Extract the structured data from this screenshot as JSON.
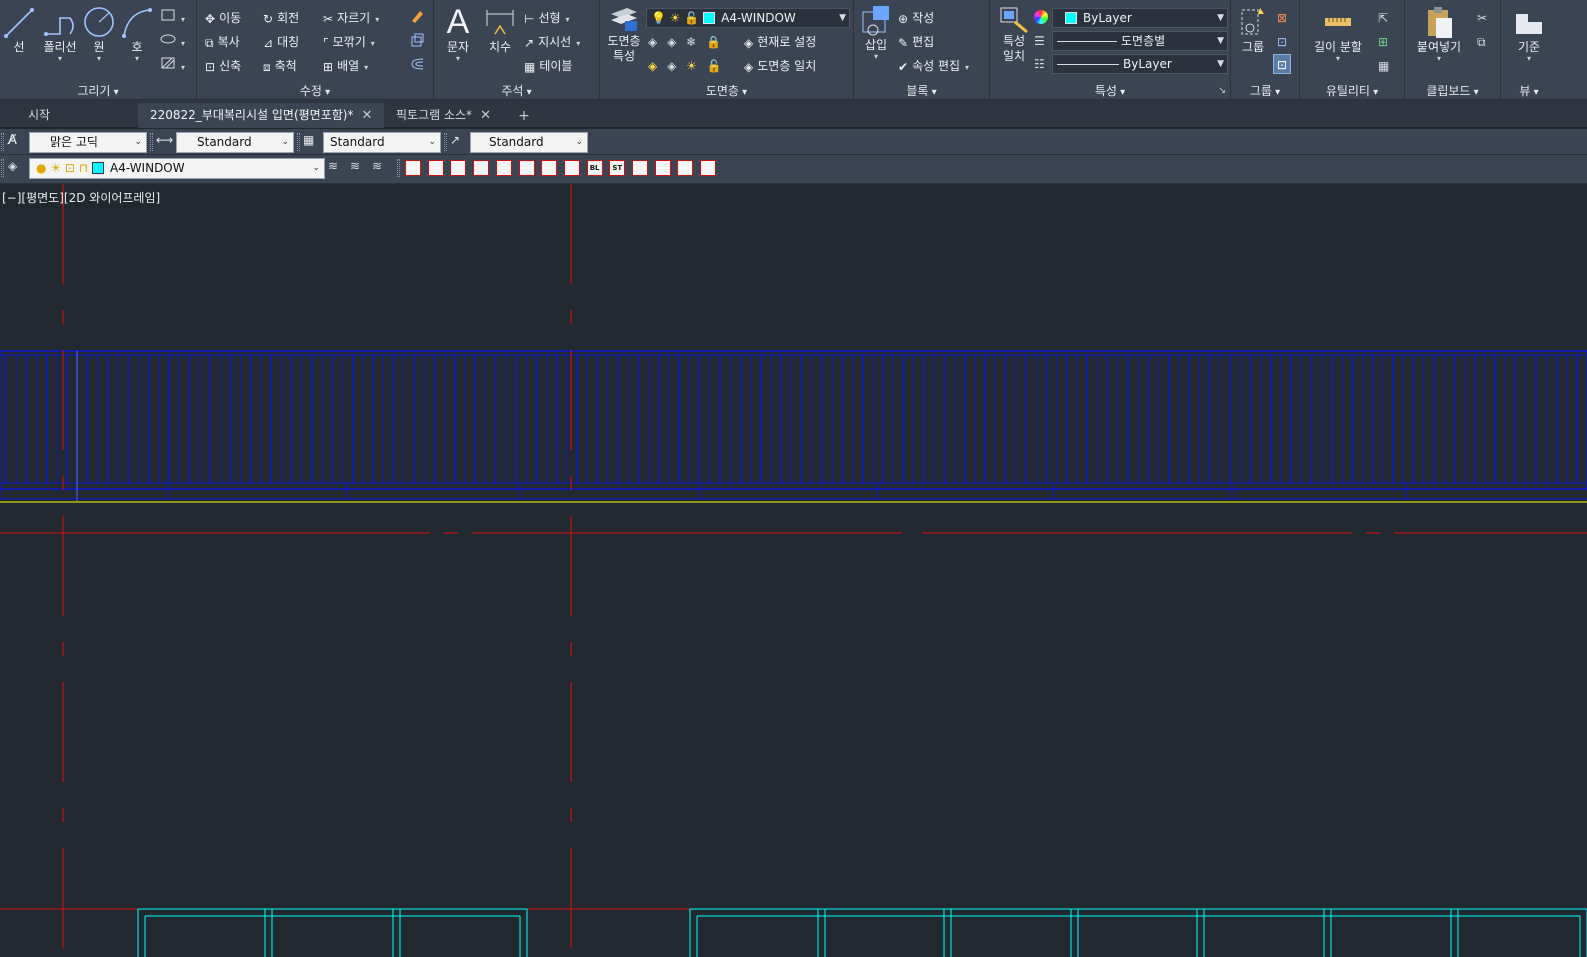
{
  "ribbon": {
    "draw": {
      "title": "그리기",
      "line": "선",
      "polyline": "폴리선",
      "circle": "원",
      "arc": "호"
    },
    "modify": {
      "title": "수정",
      "move": "이동",
      "rotate": "회전",
      "trim": "자르기",
      "copy": "복사",
      "mirror": "대칭",
      "fillet": "모깎기",
      "stretch": "신축",
      "scale": "축척",
      "array": "배열"
    },
    "annotation": {
      "title": "주석",
      "text": "문자",
      "dimension": "치수",
      "linear": "선형",
      "leader": "지시선",
      "table": "테이블"
    },
    "layers": {
      "title": "도면층",
      "properties_line1": "도면층",
      "properties_line2": "특성",
      "current_layer": "A4-WINDOW",
      "set_current": "현재로 설정",
      "match_layer": "도면층 일치"
    },
    "block": {
      "title": "블록",
      "insert": "삽입",
      "create": "작성",
      "edit": "편집",
      "edit_attributes": "속성 편집"
    },
    "properties": {
      "title": "특성",
      "match_line1": "특성",
      "match_line2": "일치",
      "color": "ByLayer",
      "lineweight": "도면층별",
      "linetype": "ByLayer"
    },
    "groups": {
      "title": "그룹",
      "group": "그룹"
    },
    "utilities": {
      "title": "유틸리티",
      "measure": "길이 분할"
    },
    "clipboard": {
      "title": "클립보드",
      "paste": "붙여넣기"
    },
    "view": {
      "title": "뷰",
      "base": "기준"
    }
  },
  "tabs": [
    {
      "label": "시작"
    },
    {
      "label": "220822_부대복리시설 입면(평면포함)*"
    },
    {
      "label": "픽토그램 소스*"
    }
  ],
  "toolbar1": {
    "text_style": "맑은 고딕",
    "dim_style": "Standard",
    "table_style": "Standard",
    "mleader_style": "Standard"
  },
  "toolbar2": {
    "layer": "A4-WINDOW",
    "mini_icons": [
      "",
      "",
      "",
      "",
      "",
      "",
      "",
      "",
      "BL",
      "ST",
      "",
      "",
      "",
      ""
    ]
  },
  "viewport": {
    "label": "[−][평면도][2D 와이어프레임]"
  },
  "colors": {
    "ribbon_bg": "#3b4453",
    "canvas_bg": "#212830",
    "layer_cyan": "#00ffff",
    "window_blue": "#0c17d6",
    "axis_red": "#e01010",
    "ground_yellow": "#ffff00"
  }
}
